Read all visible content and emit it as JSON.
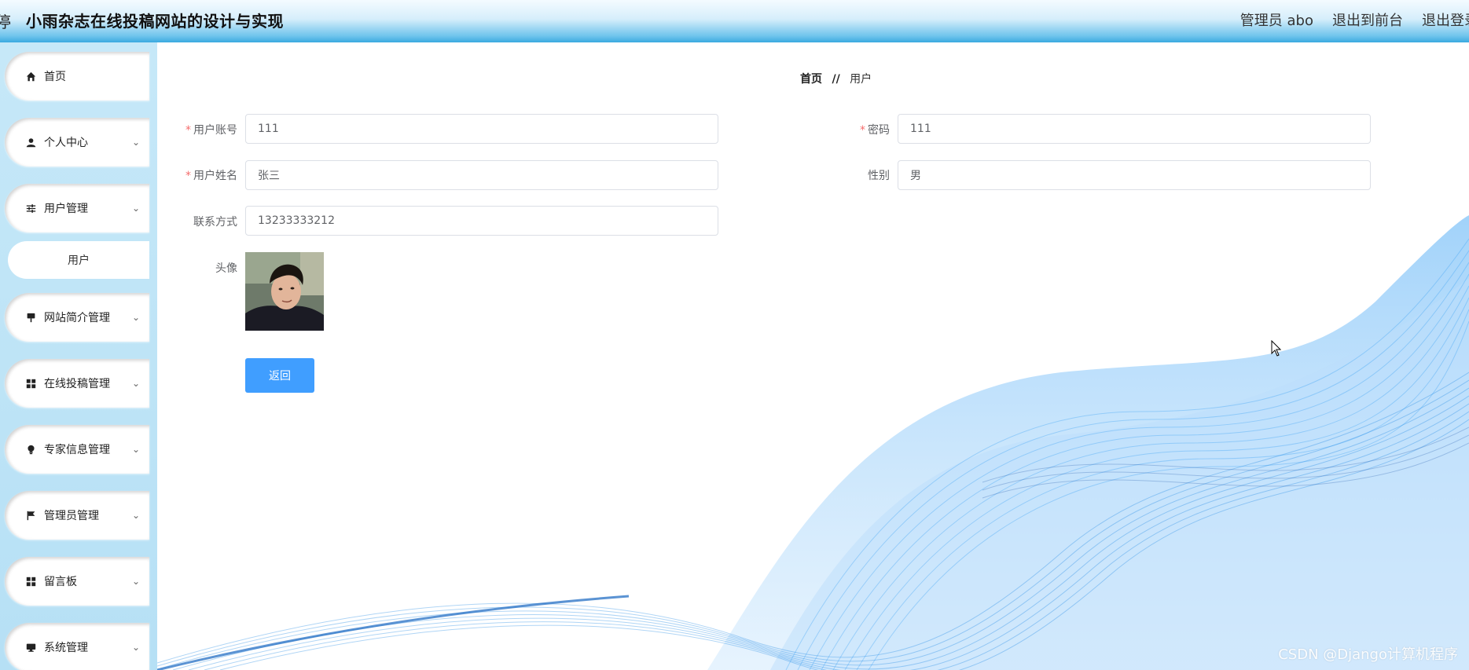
{
  "header": {
    "left_glyph": "停",
    "title": "小雨杂志在线投稿网站的设计与实现",
    "user": "管理员 abo",
    "to_front": "退出到前台",
    "logout": "退出登录"
  },
  "sidebar": {
    "items": [
      {
        "label": "首页",
        "icon": "home-icon"
      },
      {
        "label": "个人中心",
        "icon": "person-icon"
      },
      {
        "label": "用户管理",
        "icon": "sliders-icon"
      },
      {
        "label": "网站简介管理",
        "icon": "pin-icon"
      },
      {
        "label": "在线投稿管理",
        "icon": "grid-icon"
      },
      {
        "label": "专家信息管理",
        "icon": "bulb-icon"
      },
      {
        "label": "管理员管理",
        "icon": "flag-icon"
      },
      {
        "label": "留言板",
        "icon": "grid-icon"
      },
      {
        "label": "系统管理",
        "icon": "monitor-icon"
      }
    ],
    "sub_item": "用户"
  },
  "breadcrumb": {
    "home": "首页",
    "sep": "//",
    "current": "用户"
  },
  "form": {
    "account_label": "用户账号",
    "account_value": "111",
    "password_label": "密码",
    "password_value": "111",
    "name_label": "用户姓名",
    "name_value": "张三",
    "gender_label": "性别",
    "gender_value": "男",
    "phone_label": "联系方式",
    "phone_value": "13233333212",
    "avatar_label": "头像",
    "required_mark": "*"
  },
  "back_button": "返回",
  "watermark": "CSDN @Django计算机程序",
  "colors": {
    "primary": "#409eff",
    "required": "#f56c6c",
    "sidebar_bg": "#c6e8f8"
  }
}
